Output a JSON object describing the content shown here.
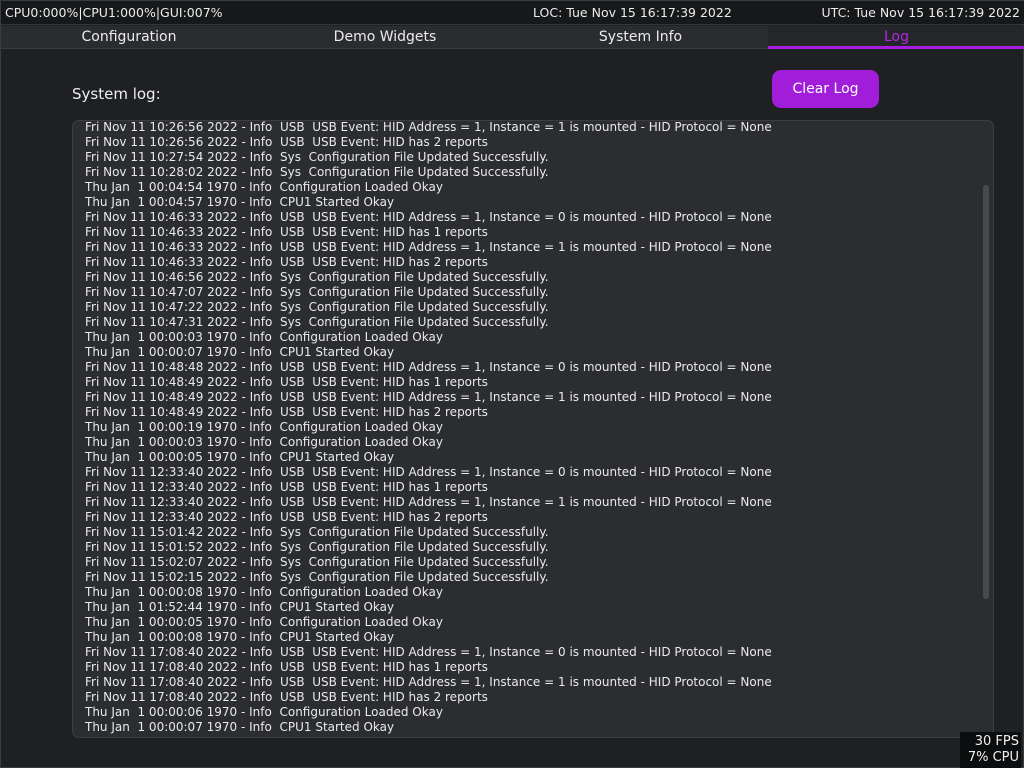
{
  "status_bar": {
    "cpu_stats": "CPU0:000%|CPU1:000%|GUI:007%",
    "local_time": "LOC: Tue Nov 15 16:17:39 2022",
    "utc_time": "UTC: Tue Nov 15 16:17:39 2022"
  },
  "tabs": [
    {
      "label": "Configuration"
    },
    {
      "label": "Demo Widgets"
    },
    {
      "label": "System Info"
    },
    {
      "label": "Log",
      "active": true
    }
  ],
  "log_view": {
    "title": "System log:",
    "clear_button_label": "Clear Log",
    "lines": [
      "Fri Nov 11 10:26:56 2022 - Info  USB  USB Event: HID Address = 1, Instance = 1 is mounted - HID Protocol = None",
      "Fri Nov 11 10:26:56 2022 - Info  USB  USB Event: HID has 2 reports",
      "Fri Nov 11 10:27:54 2022 - Info  Sys  Configuration File Updated Successfully.",
      "Fri Nov 11 10:28:02 2022 - Info  Sys  Configuration File Updated Successfully.",
      "Thu Jan  1 00:04:54 1970 - Info  Configuration Loaded Okay",
      "Thu Jan  1 00:04:57 1970 - Info  CPU1 Started Okay",
      "Fri Nov 11 10:46:33 2022 - Info  USB  USB Event: HID Address = 1, Instance = 0 is mounted - HID Protocol = None",
      "Fri Nov 11 10:46:33 2022 - Info  USB  USB Event: HID has 1 reports",
      "Fri Nov 11 10:46:33 2022 - Info  USB  USB Event: HID Address = 1, Instance = 1 is mounted - HID Protocol = None",
      "Fri Nov 11 10:46:33 2022 - Info  USB  USB Event: HID has 2 reports",
      "Fri Nov 11 10:46:56 2022 - Info  Sys  Configuration File Updated Successfully.",
      "Fri Nov 11 10:47:07 2022 - Info  Sys  Configuration File Updated Successfully.",
      "Fri Nov 11 10:47:22 2022 - Info  Sys  Configuration File Updated Successfully.",
      "Fri Nov 11 10:47:31 2022 - Info  Sys  Configuration File Updated Successfully.",
      "Thu Jan  1 00:00:03 1970 - Info  Configuration Loaded Okay",
      "Thu Jan  1 00:00:07 1970 - Info  CPU1 Started Okay",
      "Fri Nov 11 10:48:48 2022 - Info  USB  USB Event: HID Address = 1, Instance = 0 is mounted - HID Protocol = None",
      "Fri Nov 11 10:48:49 2022 - Info  USB  USB Event: HID has 1 reports",
      "Fri Nov 11 10:48:49 2022 - Info  USB  USB Event: HID Address = 1, Instance = 1 is mounted - HID Protocol = None",
      "Fri Nov 11 10:48:49 2022 - Info  USB  USB Event: HID has 2 reports",
      "Thu Jan  1 00:00:19 1970 - Info  Configuration Loaded Okay",
      "Thu Jan  1 00:00:03 1970 - Info  Configuration Loaded Okay",
      "Thu Jan  1 00:00:05 1970 - Info  CPU1 Started Okay",
      "Fri Nov 11 12:33:40 2022 - Info  USB  USB Event: HID Address = 1, Instance = 0 is mounted - HID Protocol = None",
      "Fri Nov 11 12:33:40 2022 - Info  USB  USB Event: HID has 1 reports",
      "Fri Nov 11 12:33:40 2022 - Info  USB  USB Event: HID Address = 1, Instance = 1 is mounted - HID Protocol = None",
      "Fri Nov 11 12:33:40 2022 - Info  USB  USB Event: HID has 2 reports",
      "Fri Nov 11 15:01:42 2022 - Info  Sys  Configuration File Updated Successfully.",
      "Fri Nov 11 15:01:52 2022 - Info  Sys  Configuration File Updated Successfully.",
      "Fri Nov 11 15:02:07 2022 - Info  Sys  Configuration File Updated Successfully.",
      "Fri Nov 11 15:02:15 2022 - Info  Sys  Configuration File Updated Successfully.",
      "Thu Jan  1 00:00:08 1970 - Info  Configuration Loaded Okay",
      "Thu Jan  1 01:52:44 1970 - Info  CPU1 Started Okay",
      "Thu Jan  1 00:00:05 1970 - Info  Configuration Loaded Okay",
      "Thu Jan  1 00:00:08 1970 - Info  CPU1 Started Okay",
      "Fri Nov 11 17:08:40 2022 - Info  USB  USB Event: HID Address = 1, Instance = 0 is mounted - HID Protocol = None",
      "Fri Nov 11 17:08:40 2022 - Info  USB  USB Event: HID has 1 reports",
      "Fri Nov 11 17:08:40 2022 - Info  USB  USB Event: HID Address = 1, Instance = 1 is mounted - HID Protocol = None",
      "Fri Nov 11 17:08:40 2022 - Info  USB  USB Event: HID has 2 reports",
      "Thu Jan  1 00:00:06 1970 - Info  Configuration Loaded Okay",
      "Thu Jan  1 00:00:07 1970 - Info  CPU1 Started Okay"
    ]
  },
  "perf_overlay": {
    "fps": "30 FPS",
    "cpu": "7% CPU"
  },
  "colors": {
    "accent": "#a11dd9",
    "background": "#1e2023",
    "panel": "#2b2d30"
  }
}
